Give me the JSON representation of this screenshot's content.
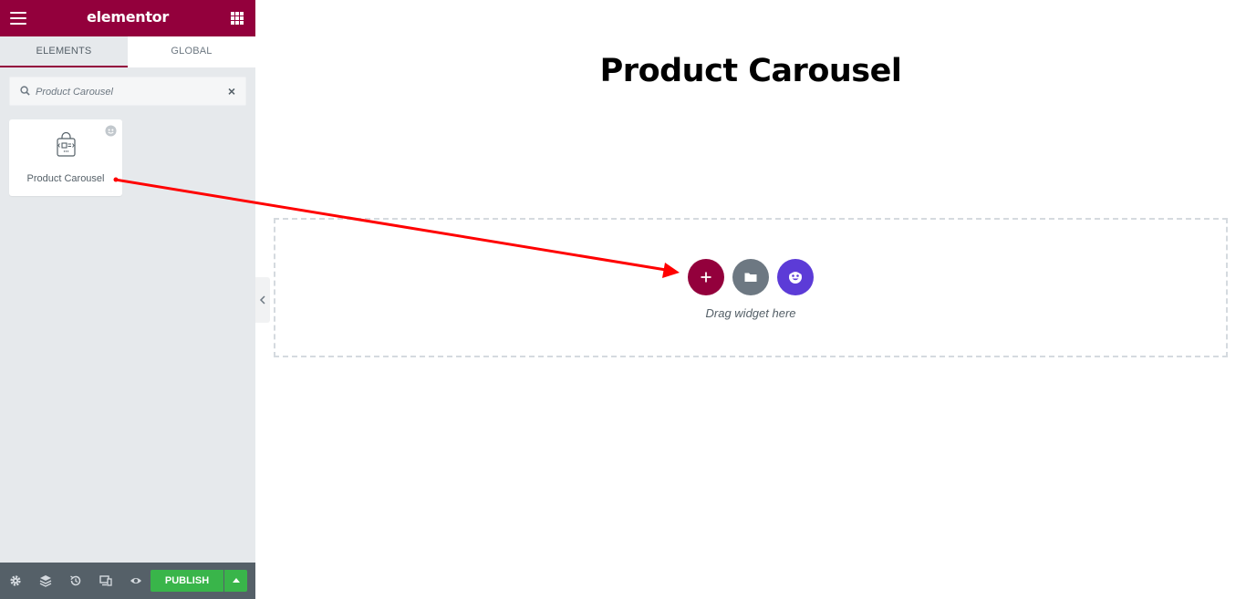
{
  "panel": {
    "brand": "elementor",
    "tabs": [
      {
        "label": "ELEMENTS"
      },
      {
        "label": "GLOBAL"
      }
    ],
    "search": {
      "value": "Product Carousel"
    },
    "widget": {
      "label": "Product Carousel"
    },
    "footer": {
      "publish_label": "PUBLISH"
    }
  },
  "canvas": {
    "title": "Product Carousel",
    "drop_hint": "Drag widget here"
  },
  "colors": {
    "brand": "#93003c",
    "publish": "#39b54a",
    "emoji_button": "#5c3bd7",
    "template_button": "#6d7882"
  }
}
